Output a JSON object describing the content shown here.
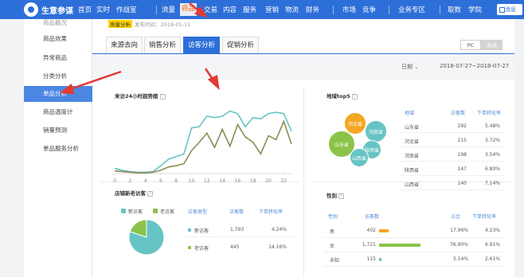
{
  "topbar": {
    "brand": "生意参谋",
    "nav": [
      "首页",
      "实时",
      "作战室",
      "流量",
      "商品",
      "交易",
      "内容",
      "服务",
      "营销",
      "物流",
      "财务",
      "市场",
      "竞争",
      "业务专区",
      "取数",
      "学院"
    ],
    "message": "消息"
  },
  "sidebar": {
    "items": [
      "商品概况",
      "商品效果",
      "异常商品",
      "分类分析",
      "单品分析",
      "商品温度计",
      "销量预测",
      "单品服务分析"
    ]
  },
  "header": {
    "tag": "质量分析",
    "publish_time": "发布时间：2018-01-11"
  },
  "tabs": [
    "来源去向",
    "销售分析",
    "访客分析",
    "促销分析"
  ],
  "device_toggle": [
    "PC",
    "无线"
  ],
  "date": {
    "label": "日期",
    "range": "2018-07-27~2018-07-27"
  },
  "hourly": {
    "title": "来访24小时趋势图",
    "x_ticks": [
      "0",
      "2",
      "4",
      "6",
      "8",
      "10",
      "12",
      "14",
      "16",
      "18",
      "20",
      "22"
    ]
  },
  "region": {
    "title": "地域top5",
    "headers": [
      "地域",
      "访客数",
      "下单转化率"
    ],
    "rows": [
      {
        "name": "山东省",
        "visitors": "292",
        "rate": "5.48%"
      },
      {
        "name": "河北省",
        "visitors": "215",
        "rate": "3.72%"
      },
      {
        "name": "河南省",
        "visitors": "198",
        "rate": "3.54%"
      },
      {
        "name": "陕西省",
        "visitors": "147",
        "rate": "6.80%"
      },
      {
        "name": "山西省",
        "visitors": "140",
        "rate": "7.14%"
      }
    ],
    "bubbles": [
      "河北省",
      "河南省",
      "山东省",
      "陕西省",
      "山西省"
    ]
  },
  "newold": {
    "title": "店铺新老访客",
    "legend": [
      "新访客",
      "老访客"
    ],
    "headers": [
      "访客类型",
      "访客数",
      "下单转化率"
    ],
    "rows": [
      {
        "type": "新访客",
        "visitors": "1,793",
        "rate": "4.24%"
      },
      {
        "type": "老访客",
        "visitors": "445",
        "rate": "14.16%"
      }
    ]
  },
  "gender": {
    "title": "性别",
    "headers": [
      "性别",
      "访客数",
      "占比",
      "下单转化率"
    ],
    "rows": [
      {
        "name": "男",
        "visitors": "402",
        "share": "17.96%",
        "rate": "4.23%"
      },
      {
        "name": "女",
        "visitors": "1,721",
        "share": "76.90%",
        "rate": "6.91%"
      },
      {
        "name": "未知",
        "visitors": "115",
        "share": "5.14%",
        "rate": "2.61%"
      }
    ]
  },
  "colors": {
    "primary": "#2d6fd8",
    "teal": "#67c4c4",
    "olive": "#8b8b55",
    "green": "#8bc34a",
    "orange": "#f5a623",
    "annotation": "#e53935"
  },
  "chart_data": [
    {
      "type": "line",
      "x": [
        0,
        1,
        2,
        3,
        4,
        5,
        6,
        7,
        8,
        9,
        10,
        11,
        12,
        13,
        14,
        15,
        16,
        17,
        18,
        19,
        20,
        21,
        22,
        23
      ],
      "series": [
        {
          "values": [
            8,
            5,
            3,
            2,
            2,
            3,
            12,
            22,
            26,
            30,
            70,
            72,
            88,
            86,
            88,
            96,
            92,
            72,
            86,
            84,
            92,
            94,
            92,
            65
          ]
        },
        {
          "values": [
            4,
            3,
            2,
            1,
            1,
            2,
            5,
            10,
            12,
            15,
            35,
            48,
            62,
            40,
            68,
            42,
            75,
            56,
            48,
            30,
            58,
            52,
            80,
            45
          ]
        }
      ],
      "ylim": [
        0,
        110
      ]
    },
    {
      "type": "pie",
      "categories": [
        "新访客",
        "老访客"
      ],
      "values": [
        1793,
        445
      ]
    },
    {
      "type": "bar",
      "categories": [
        "男",
        "女",
        "未知"
      ],
      "values": [
        402,
        1721,
        115
      ]
    }
  ]
}
